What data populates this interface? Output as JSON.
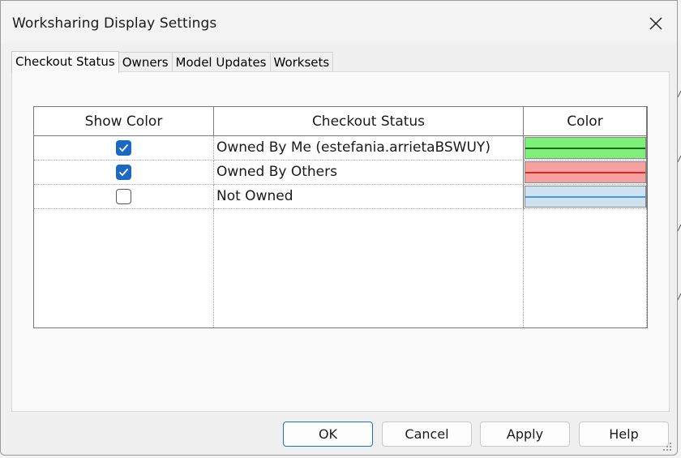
{
  "dialog": {
    "title": "Worksharing Display Settings"
  },
  "tabs": [
    {
      "label": "Checkout Status",
      "active": true
    },
    {
      "label": "Owners",
      "active": false
    },
    {
      "label": "Model Updates",
      "active": false
    },
    {
      "label": "Worksets",
      "active": false
    }
  ],
  "table": {
    "headers": {
      "show_color": "Show Color",
      "checkout_status": "Checkout Status",
      "color": "Color"
    },
    "rows": [
      {
        "checked": true,
        "status": "Owned By Me (estefania.arrietaBSWUY)",
        "fill": "#7ef07a",
        "line": "#1a6e1a"
      },
      {
        "checked": true,
        "status": "Owned By Others",
        "fill": "#f7a0a0",
        "line": "#d62a2a"
      },
      {
        "checked": false,
        "status": "Not Owned",
        "fill": "#cfe2f1",
        "line": "#4a9ad4"
      }
    ]
  },
  "buttons": {
    "ok": "OK",
    "cancel": "Cancel",
    "apply": "Apply",
    "help": "Help"
  },
  "icons": {
    "close": "close-icon",
    "check": "checkmark-icon",
    "grip": "resize-grip-icon"
  },
  "colors": {
    "accent": "#1a6ac5"
  }
}
